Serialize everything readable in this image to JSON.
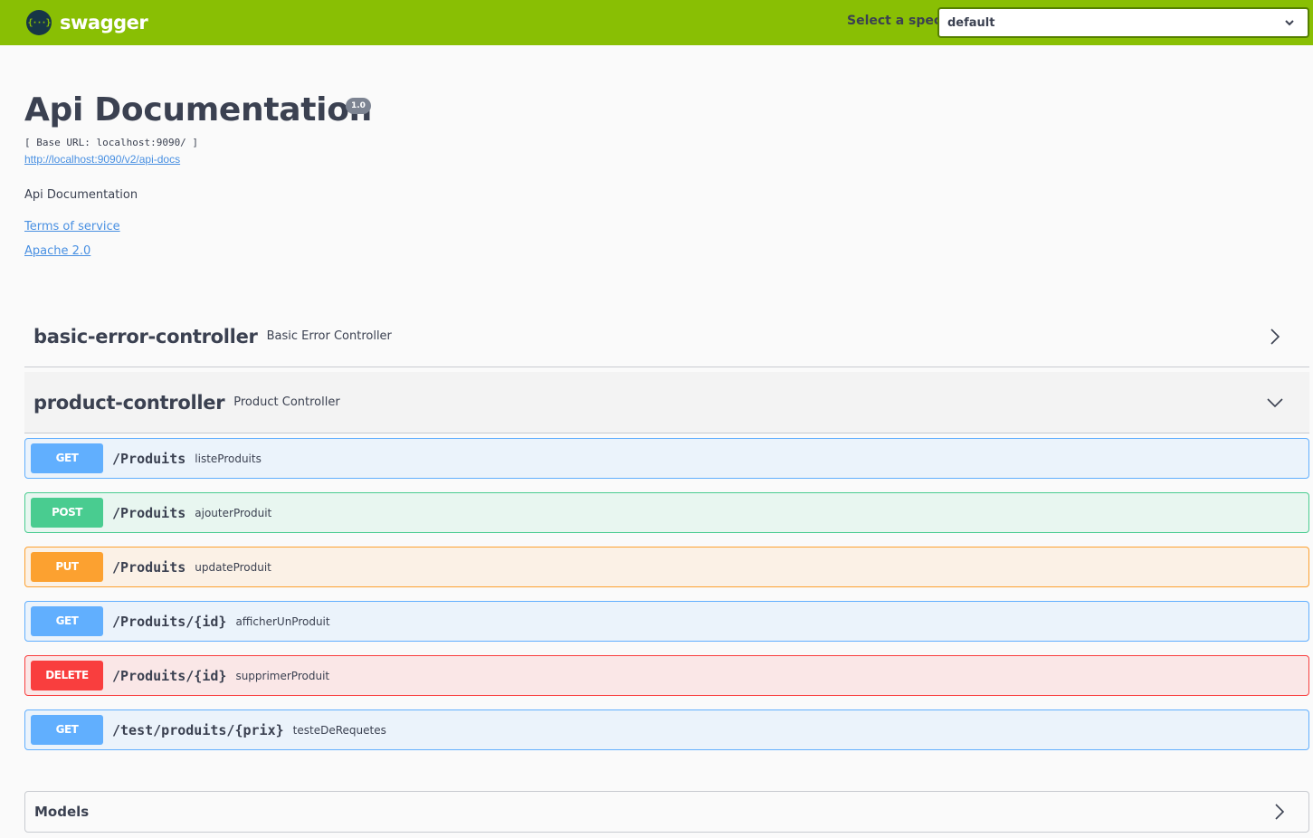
{
  "topbar": {
    "logo_glyph": "{···}",
    "logo_text": "swagger",
    "spec_label": "Select a spec",
    "spec_value": "default",
    "colors": {
      "background": "#89bf04",
      "logo_icon": "#173647"
    }
  },
  "info": {
    "title": "Api Documentation",
    "version": "1.0",
    "base_url": "[ Base URL: localhost:9090/ ]",
    "api_docs_link": "http://localhost:9090/v2/api-docs",
    "description": "Api Documentation",
    "terms_link": "Terms of service",
    "license_link": "Apache 2.0"
  },
  "tags": [
    {
      "name": "basic-error-controller",
      "description": "Basic Error Controller",
      "expanded": false
    },
    {
      "name": "product-controller",
      "description": "Product Controller",
      "expanded": true
    }
  ],
  "operations": [
    {
      "method": "GET",
      "path": "/Produits",
      "summary": "listeProduits"
    },
    {
      "method": "POST",
      "path": "/Produits",
      "summary": "ajouterProduit"
    },
    {
      "method": "PUT",
      "path": "/Produits",
      "summary": "updateProduit"
    },
    {
      "method": "GET",
      "path": "/Produits/{id}",
      "summary": "afficherUnProduit"
    },
    {
      "method": "DELETE",
      "path": "/Produits/{id}",
      "summary": "supprimerProduit"
    },
    {
      "method": "GET",
      "path": "/test/produits/{prix}",
      "summary": "testeDeRequetes"
    }
  ],
  "method_colors": {
    "GET": "#61affe",
    "POST": "#49cc90",
    "PUT": "#fca130",
    "DELETE": "#f93e3e"
  },
  "models": {
    "title": "Models"
  },
  "icons": [
    "swagger-logo-icon",
    "chevron-down-icon",
    "chevron-right-icon"
  ]
}
